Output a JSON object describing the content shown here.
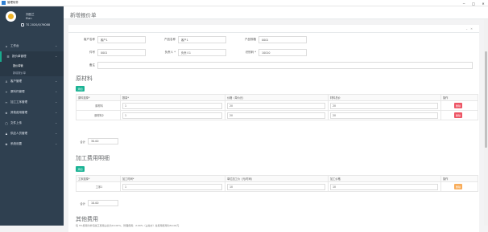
{
  "app": {
    "title": "管理软件"
  },
  "window": {
    "minimize": "−",
    "restore": "□",
    "close": "✕"
  },
  "profile": {
    "name": "刘西兰",
    "role": "Elan",
    "phone": "TS 2020/0/76088"
  },
  "sidebar": {
    "items": [
      {
        "label": "工作台",
        "icon": "home-icon",
        "glyph": "⌂"
      },
      {
        "label": "报价单管理",
        "icon": "list-icon",
        "glyph": "☰"
      },
      {
        "label": "客户管理",
        "icon": "user-icon",
        "glyph": "♙"
      },
      {
        "label": "原料件管理",
        "icon": "plus-icon",
        "glyph": "+"
      },
      {
        "label": "加工工序管理",
        "icon": "tools-icon",
        "glyph": "✂"
      },
      {
        "label": "其他费用管理",
        "icon": "cog-icon",
        "glyph": "⊗"
      },
      {
        "label": "文件上传",
        "icon": "file-icon",
        "glyph": "▢"
      },
      {
        "label": "供应人员管理",
        "icon": "person-icon",
        "glyph": "♟"
      },
      {
        "label": "系统设置",
        "icon": "settings-icon",
        "glyph": "✿"
      }
    ],
    "subitems": [
      "报价单管",
      "新增报价单"
    ]
  },
  "page": {
    "title": "新增报价单",
    "tools": [
      "⌄",
      "✕"
    ]
  },
  "form": {
    "row1": [
      {
        "label": "客户名称",
        "value": "客户1"
      },
      {
        "label": "产品名称",
        "value": "客户1"
      },
      {
        "label": "产品规格",
        "value": "0001"
      }
    ],
    "row2": [
      {
        "label": "件号",
        "value": "0001"
      },
      {
        "label": "负责人 *",
        "value": "负责人1"
      },
      {
        "label": "识别码 *",
        "value": "10010"
      }
    ],
    "row3": [
      {
        "label": "备注",
        "value": ""
      }
    ]
  },
  "materials": {
    "title": "原材料",
    "add_label": "添加",
    "headers": [
      "原料选择*",
      "数量*",
      "价格（单价元）",
      "材料总价",
      "操作"
    ],
    "rows": [
      {
        "name": "原材料",
        "qty": "1",
        "price": "20",
        "total": "20",
        "action": "删除"
      },
      {
        "name": "原材料2",
        "qty": "1",
        "price": "20",
        "total": "20",
        "action": "删除"
      }
    ],
    "total_label": "合计",
    "total_value": "30.00"
  },
  "processing": {
    "title": "加工费用明细",
    "add_label": "添加",
    "headers": [
      "工序选择*",
      "加工时间*",
      "单位加工价（元/时间）",
      "加工价格",
      "操作"
    ],
    "rows": [
      {
        "name": "工序1",
        "time": "1",
        "price": "10",
        "total": "10",
        "action": "删除"
      }
    ],
    "total_label": "合计",
    "total_value": "10.00"
  },
  "other": {
    "title": "其他费用",
    "note": "包 5%费用为外包加工费用占比为10.00%，管理费用：2.00%（占总价）总费用费用为50.00元"
  }
}
